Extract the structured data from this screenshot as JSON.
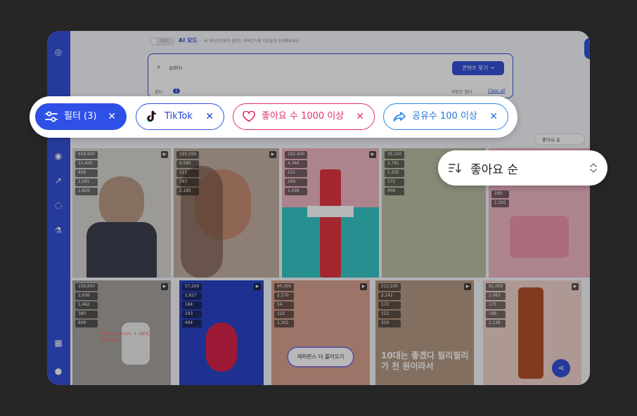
{
  "colors": {
    "background": "#262626",
    "sidebar": "#3551d9",
    "accent": "#2f50e6",
    "likes_pink": "#e0306b",
    "shares_blue": "#2a85ea"
  },
  "app": {
    "toggle_label": "OFF",
    "ai_mode_label": "AI 모드",
    "ai_mode_desc": "AI 에이전트에게 원하는 레퍼런스를 자유롭게 요청해보세요",
    "search_value": "pdrn",
    "find_button": "콘텐츠 찾기 →",
    "filter_label": "필터",
    "filter_count": "1",
    "saved_filter": "저장된 필터",
    "clear_all": "Clear all",
    "sort_mini": "좋아요 순"
  },
  "sidebar_icons": [
    "logo-icon",
    "radio-icon",
    "trend-icon",
    "chat-icon",
    "flask-icon",
    "apps-icon",
    "profile-icon"
  ],
  "filter_bar": {
    "filter_chip": "필터 (3)",
    "tiktok_chip": "TikTok",
    "likes_chip": "좋아요 수 1000 이상",
    "shares_chip": "공유수 100 이상"
  },
  "sort": {
    "label": "좋아요 순"
  },
  "grid": {
    "cells": [
      {
        "stats": [
          "658,900",
          "12,400",
          "828",
          "2,281",
          "1,829"
        ],
        "bg": "#d9d6d2"
      },
      {
        "stats": [
          "195,500",
          "6,585",
          "111",
          "593",
          "2,195"
        ],
        "bg": "#c4b0a3"
      },
      {
        "stats": [
          "182,400",
          "4,346",
          "221",
          "269",
          "1,438"
        ],
        "bg": "#36c7c7"
      },
      {
        "stats": [
          "35,100",
          "3,781",
          "1,205",
          "172",
          "406"
        ],
        "bg": "#bcc0a6"
      },
      {
        "stats": [
          "299",
          "1,302"
        ],
        "bg": "#f2b8c6"
      },
      {
        "stats": [
          "158,800",
          "2,936",
          "1,462",
          "380",
          "809"
        ],
        "bg": "#a7a39e"
      },
      {
        "stats": [
          "57,200",
          "2,827",
          "184",
          "193",
          "494"
        ],
        "bg": "#2a45c8"
      },
      {
        "stats": [
          "90,000",
          "2,170",
          "54",
          "125",
          "1,301"
        ],
        "bg": "#d9a191"
      },
      {
        "stats": [
          "212,500",
          "2,142",
          "172",
          "153",
          "318"
        ],
        "bg": "#b59a84"
      },
      {
        "stats": [
          "81,000",
          "2,063",
          "170",
          "198",
          "1,139"
        ],
        "bg": "#f0d3cc"
      }
    ],
    "reference_button": "레퍼런스 더 불러오기",
    "overlay_text_1": "10대는 좋겠다 필리필리가 천 원이라서",
    "overlay_text_2": "PDRN serum + HDC Review"
  }
}
